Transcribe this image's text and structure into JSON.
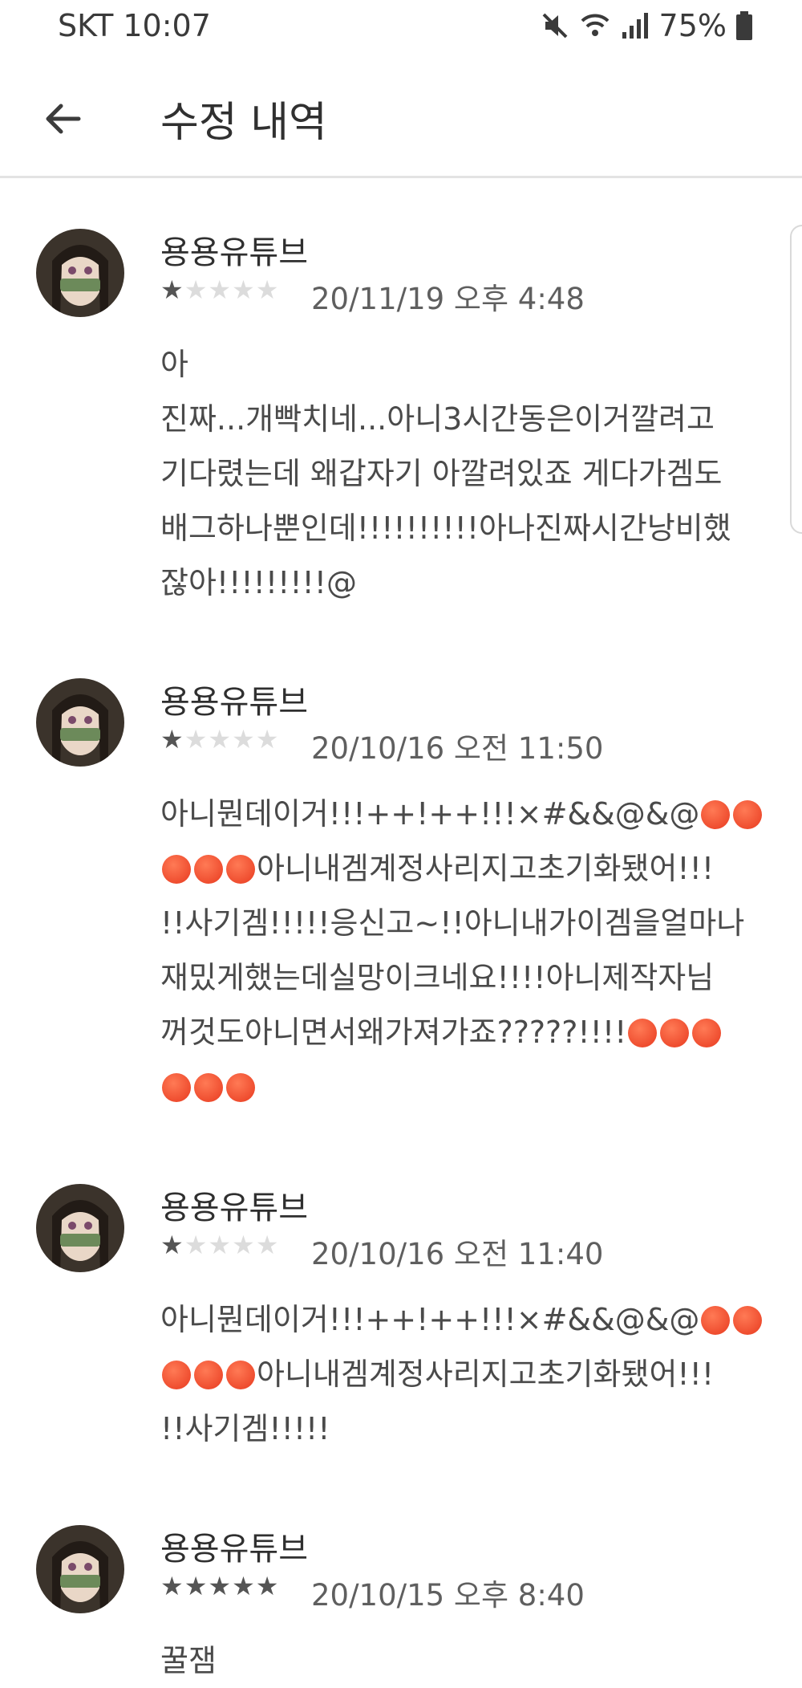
{
  "status_bar": {
    "carrier_time": "SKT 10:07",
    "battery": "75%",
    "icons": [
      "mute-icon",
      "wifi-icon",
      "signal-icon",
      "battery-icon"
    ]
  },
  "header": {
    "back_icon": "arrow-back-icon",
    "title": "수정 내역"
  },
  "reviews": [
    {
      "name": "용용유튜브",
      "stars": "★★★★★",
      "rating": 1,
      "date": "20/11/19 오후 4:48",
      "lines": [
        "아",
        "진짜...개빡치네...아니3시간동은이거깔려고",
        "기다렸는데 왜갑자기 아깔려있죠 게다가겜도",
        "배그하나뿐인데!!!!!!!!!!아나진짜시간낭비했",
        "잖아!!!!!!!!!@"
      ]
    },
    {
      "name": "용용유튜브",
      "stars": "★★★★★",
      "rating": 1,
      "date": "20/10/16 오전 11:50",
      "lines": [
        "아니뭔데이거!!!++!++!!!×#&&@&@",
        "아니내겜계정사리지고초기화됐어!!!",
        "!!사기겜!!!!!응신고~!!아니내가이겜을얼마나",
        "재밌게했는데실망이크네요!!!!아니제작자님",
        "꺼것도아니면서왜가져가죠?????!!!!",
        ""
      ]
    },
    {
      "name": "용용유튜브",
      "stars": "★★★★★",
      "rating": 1,
      "date": "20/10/16 오전 11:40",
      "lines": [
        "아니뭔데이거!!!++!++!!!×#&&@&@",
        "아니내겜계정사리지고초기화됐어!!!",
        "!!사기겜!!!!!"
      ]
    },
    {
      "name": "용용유튜브",
      "stars": "★★★★★",
      "rating": 5,
      "date": "20/10/15 오후 8:40",
      "lines": [
        "꿀잼"
      ]
    }
  ]
}
